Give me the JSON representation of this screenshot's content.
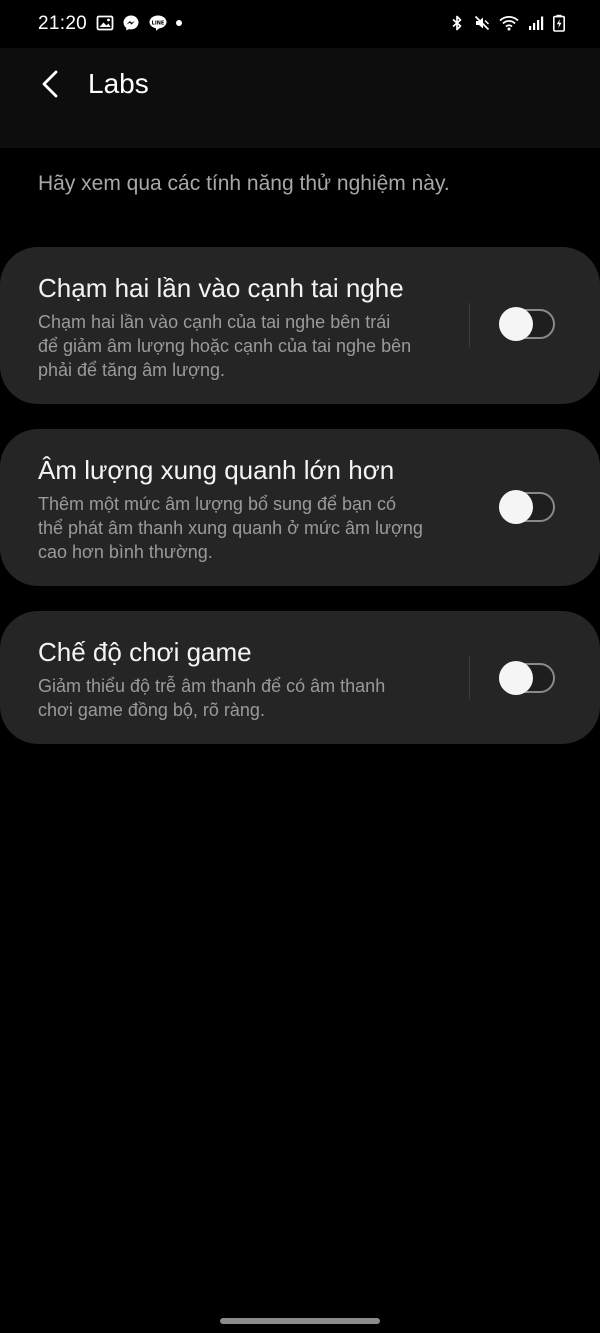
{
  "status_bar": {
    "time": "21:20",
    "left_icons": [
      "gallery-icon",
      "messenger-icon",
      "line-icon",
      "dot-icon"
    ],
    "right_icons": [
      "bluetooth-icon",
      "mute-icon",
      "wifi-icon",
      "signal-icon",
      "battery-charging-icon"
    ]
  },
  "app_bar": {
    "back_icon": "chevron-left-icon",
    "title": "Labs"
  },
  "intro": "Hãy xem qua các tính năng thử nghiệm này.",
  "features": [
    {
      "title": "Chạm hai lần vào cạnh tai nghe",
      "desc_lines": [
        "Chạm hai lần vào cạnh của tai nghe bên trái",
        "để giảm âm lượng hoặc cạnh của tai nghe bên",
        "phải để tăng âm lượng."
      ],
      "enabled": false
    },
    {
      "title": "Âm lượng xung quanh lớn hơn",
      "desc_lines": [
        "Thêm một mức âm lượng bổ sung để bạn có",
        "thể phát âm thanh xung quanh ở mức âm lượng",
        "cao hơn bình thường."
      ],
      "enabled": false
    },
    {
      "title": "Chế độ chơi game",
      "desc_lines": [
        "Giảm thiểu độ trễ âm thanh để có âm thanh",
        "chơi game đồng bộ, rõ ràng."
      ],
      "enabled": false
    }
  ],
  "colors": {
    "background": "#000000",
    "card": "#252525",
    "title_text": "#f4f4f4",
    "desc_text": "#9a9a9a",
    "toggle_off_track": "#8a8a8a"
  }
}
